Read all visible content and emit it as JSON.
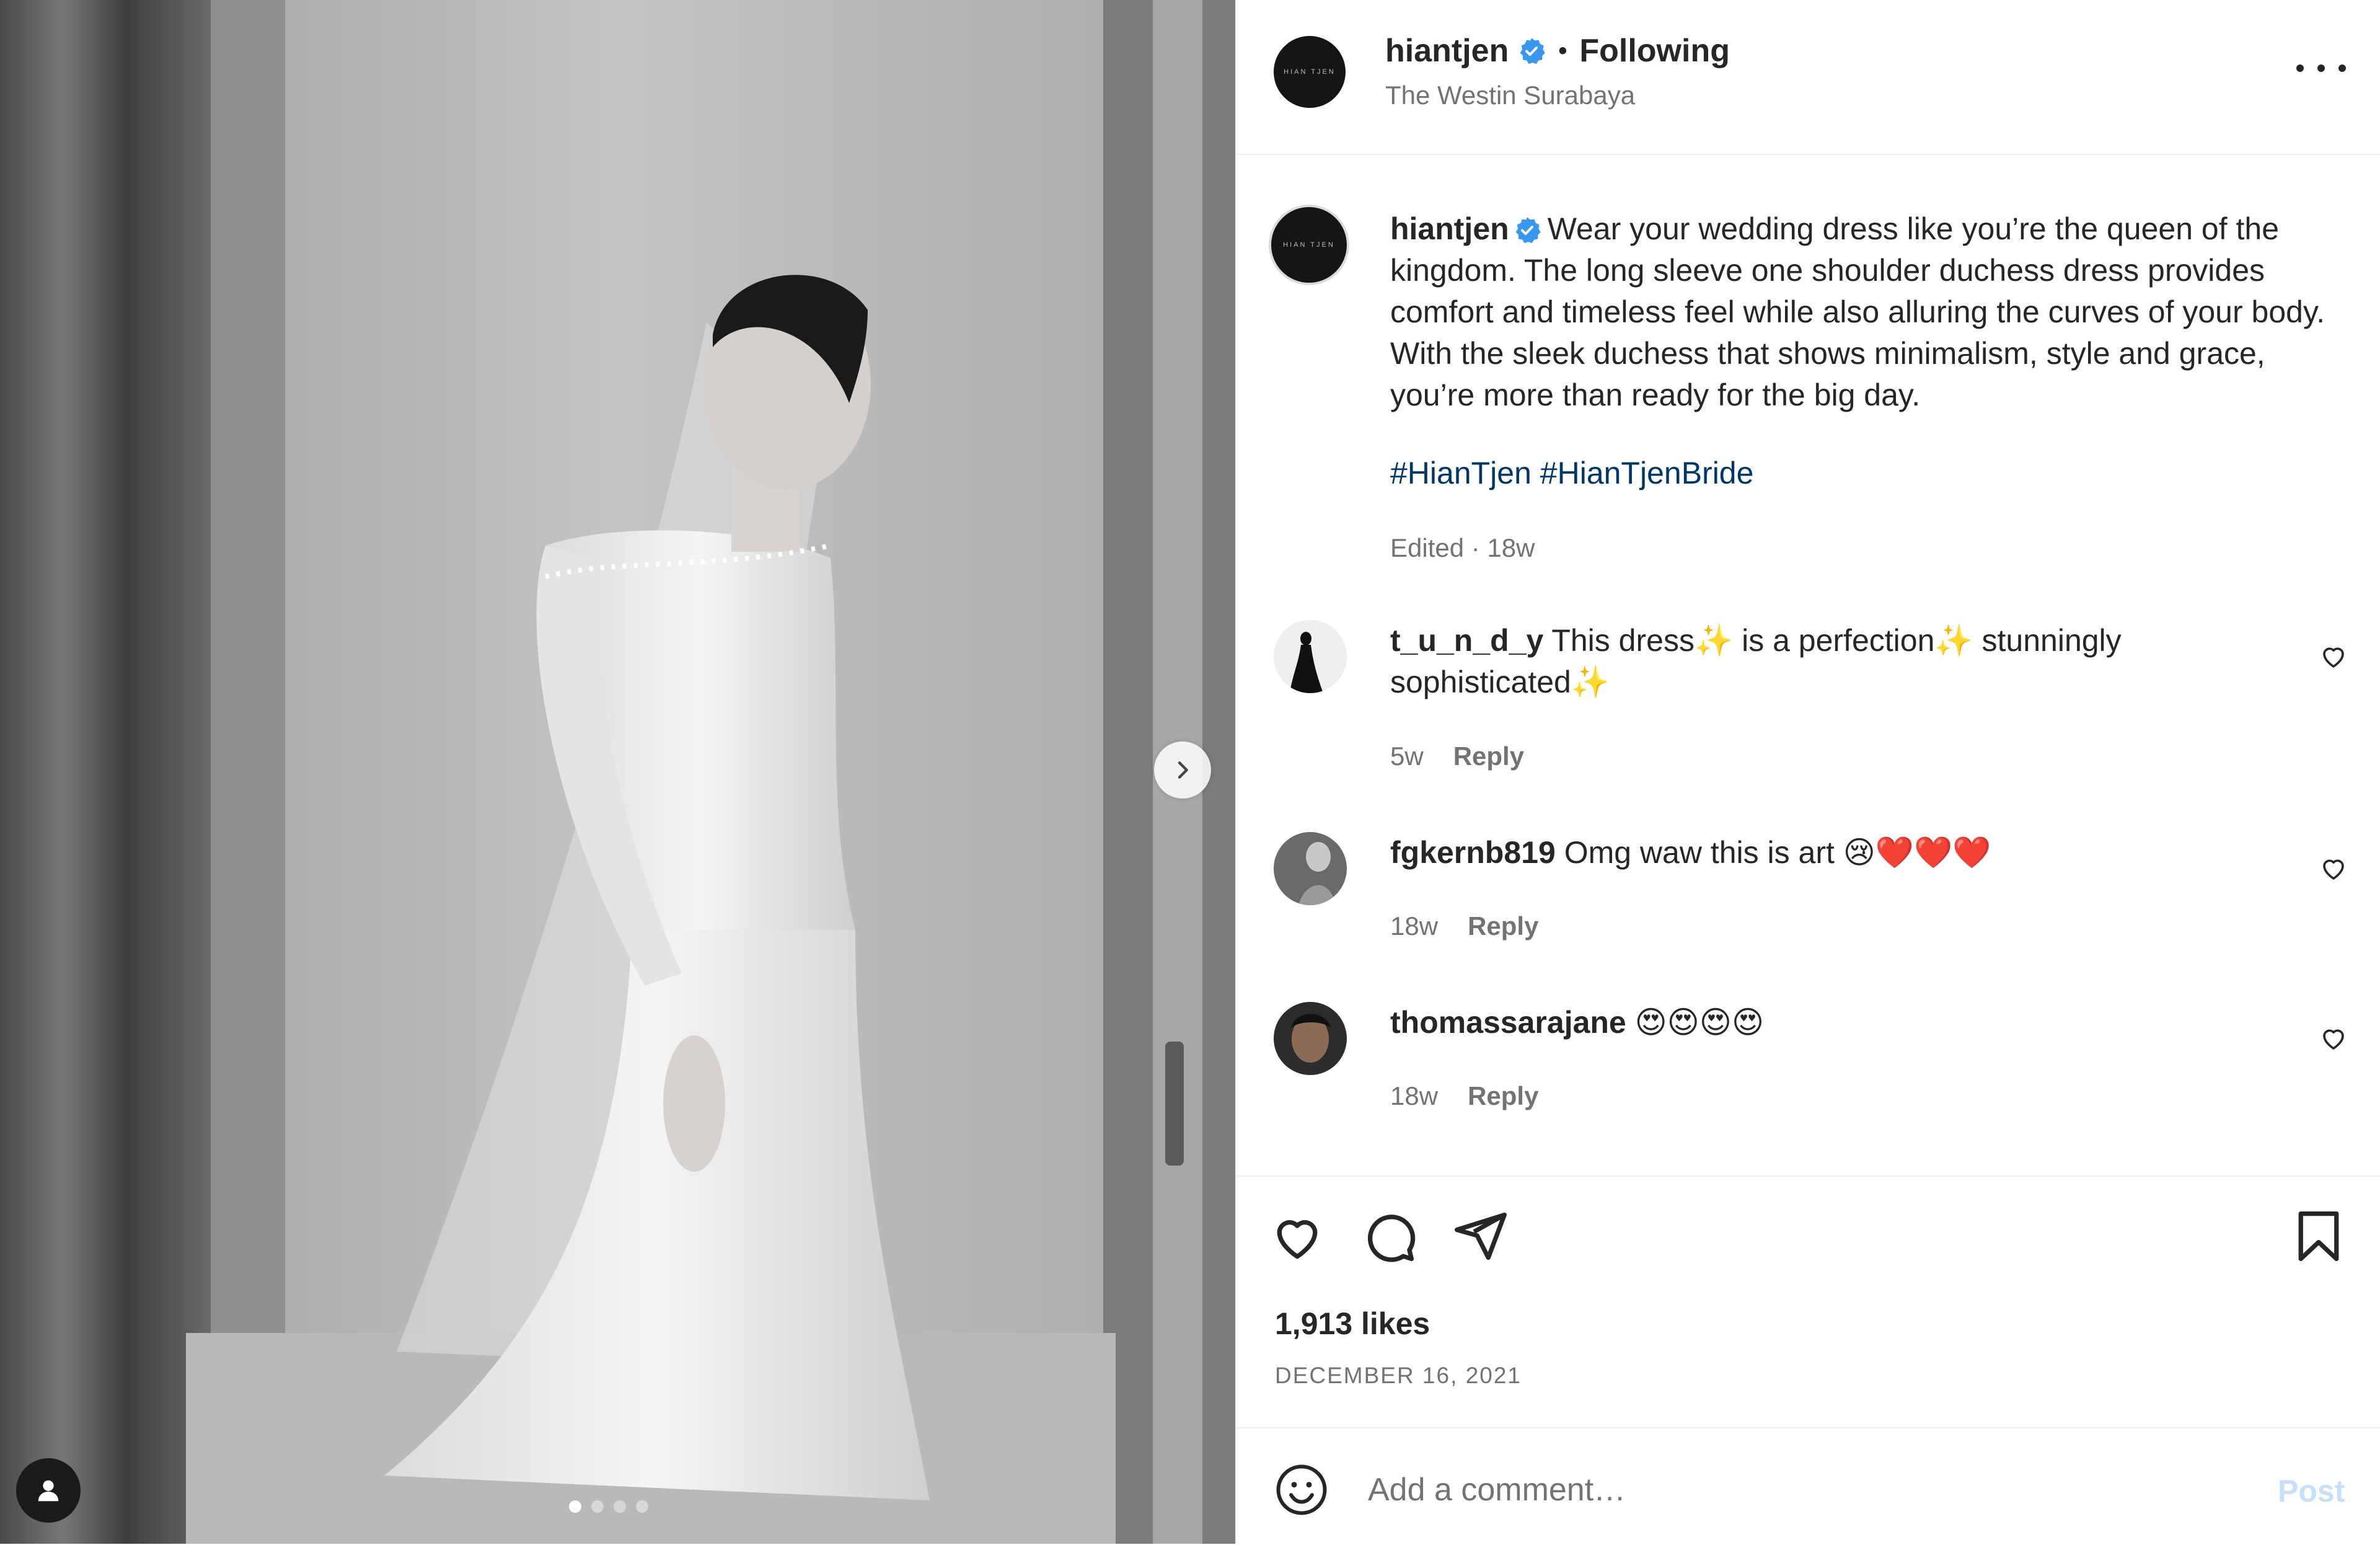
{
  "post": {
    "author": "hiantjen",
    "follow_status": "Following",
    "separator": "•",
    "location": "The Westin Surabaya",
    "brand_mark": "HIAN TJEN",
    "caption": "Wear your wedding dress like you’re the queen of the kingdom. The long sleeve one shoulder duchess dress provides comfort and timeless feel while also alluring the curves of your body. With the sleek duchess that shows minimalism, style and grace, you’re more than ready for the big day.",
    "hashtags": "#HianTjen #HianTjenBride",
    "edited": "Edited · 18w",
    "likes": "1,913 likes",
    "date": "DECEMBER 16, 2021",
    "carousel": {
      "count": 4,
      "active_index": 0
    }
  },
  "comments": [
    {
      "user": "t_u_n_d_y",
      "text": "This dress✨ is a perfection✨ stunningly sophisticated✨",
      "age": "5w",
      "reply": "Reply"
    },
    {
      "user": "fgkernb819",
      "text": "Omg waw this is art 😢❤️❤️❤️",
      "age": "18w",
      "reply": "Reply"
    },
    {
      "user": "thomassarajane",
      "text": "😍😍😍😍",
      "age": "18w",
      "reply": "Reply"
    }
  ],
  "composer": {
    "placeholder": "Add a comment…",
    "post_label": "Post"
  },
  "icons": {
    "verified": "verified-badge-icon",
    "more": "more-options-icon",
    "next": "chevron-right-icon",
    "user_tag": "user-tag-icon",
    "like": "heart-icon",
    "comment": "comment-bubble-icon",
    "share": "paper-plane-icon",
    "save": "bookmark-icon",
    "emoji": "emoji-icon"
  },
  "colors": {
    "verified": "#3897f0",
    "link": "#00376b",
    "post_disabled": "#c7e0f9",
    "muted": "#737373"
  }
}
